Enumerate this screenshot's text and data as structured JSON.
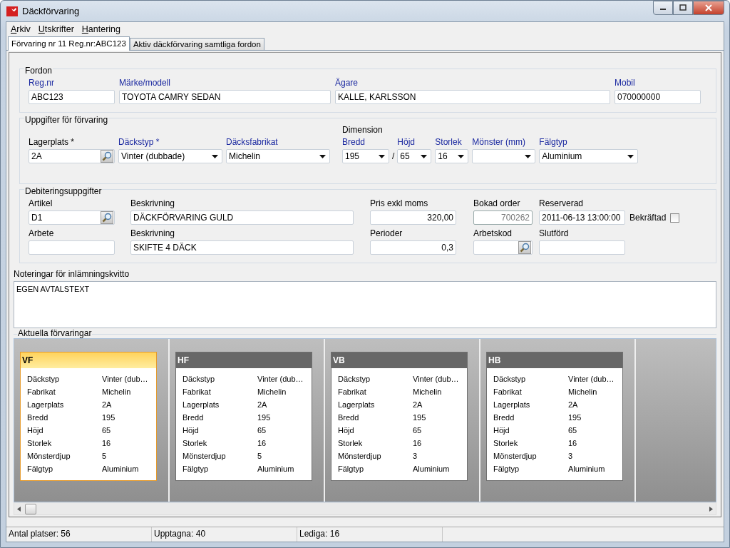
{
  "window": {
    "title": "Däckförvaring"
  },
  "menu": [
    {
      "label": "Arkiv"
    },
    {
      "label": "Utskrifter"
    },
    {
      "label": "Hantering"
    }
  ],
  "tabs": [
    {
      "label": "Förvaring nr 11 Reg.nr:ABC123",
      "selected": true
    },
    {
      "label": "Aktiv däckförvaring samtliga fordon",
      "selected": false
    }
  ],
  "fordon": {
    "title": "Fordon",
    "fields": [
      {
        "label": "Reg.nr",
        "highlighted": true,
        "kind": "text",
        "value": "ABC123"
      },
      {
        "label": "Märke/modell",
        "highlighted": true,
        "kind": "text",
        "value": "TOYOTA CAMRY SEDAN"
      },
      {
        "label": "Ägare",
        "highlighted": true,
        "kind": "text",
        "value": "KALLE, KARLSSON"
      },
      {
        "label": "Mobil",
        "highlighted": true,
        "kind": "text",
        "value": "070000000"
      }
    ]
  },
  "forvaring": {
    "title": "Uppgifter för förvaring",
    "dimension_label": "Dimension",
    "separator": "/",
    "fields": [
      {
        "label": "Lagerplats *",
        "highlighted": false,
        "kind": "lookup",
        "value": "2A"
      },
      {
        "label": "Däckstyp *",
        "highlighted": true,
        "kind": "combo",
        "value": "Vinter (dubbade)"
      },
      {
        "label": "Däcksfabrikat",
        "highlighted": true,
        "kind": "combo",
        "value": "Michelin"
      },
      {
        "label": "Bredd",
        "highlighted": true,
        "kind": "combo",
        "value": "195"
      },
      {
        "label": "Höjd",
        "highlighted": true,
        "kind": "combo",
        "value": "65"
      },
      {
        "label": "Storlek",
        "highlighted": true,
        "kind": "combo",
        "value": "16"
      },
      {
        "label": "Mönster (mm)",
        "highlighted": true,
        "kind": "combo"
      },
      {
        "label": "Fälgtyp",
        "highlighted": true,
        "kind": "combo",
        "value": "Aluminium"
      }
    ]
  },
  "debitering": {
    "title": "Debiteringsuppgifter",
    "rows": [
      [
        {
          "label": "Artikel",
          "kind": "lookup",
          "value": "D1"
        },
        {
          "label": "Beskrivning",
          "kind": "text",
          "value": "DÄCKFÖRVARING GULD"
        },
        {
          "label": "Pris exkl moms",
          "kind": "number",
          "value": "320,00"
        },
        {
          "label": "Bokad order",
          "kind": "readonly",
          "value": "700262"
        },
        {
          "label": "Reserverad",
          "kind": "text",
          "value": "2011-06-13 13:00:00"
        },
        {
          "label": "Bekräftad",
          "kind": "checkbox",
          "checked": false
        }
      ],
      [
        {
          "label": "Arbete",
          "kind": "text"
        },
        {
          "label": "Beskrivning",
          "kind": "text",
          "value": "SKIFTE 4 DÄCK"
        },
        {
          "label": "Perioder",
          "kind": "number",
          "value": "0,3"
        },
        {
          "label": "Arbetskod",
          "kind": "lookup"
        },
        {
          "label": "Slutförd",
          "kind": "text"
        }
      ]
    ]
  },
  "notes": {
    "label": "Noteringar för inlämningskvitto",
    "value": "EGEN AVTALSTEXT"
  },
  "storage": {
    "title": "Aktuella förvaringar",
    "cards": [
      {
        "title": "VF",
        "selected": true,
        "rows": [
          {
            "label": "Däckstyp",
            "value": "Vinter (dub…"
          },
          {
            "label": "Fabrikat",
            "value": "Michelin"
          },
          {
            "label": "Lagerplats",
            "value": "2A"
          },
          {
            "label": "Bredd",
            "value": "195"
          },
          {
            "label": "Höjd",
            "value": "65"
          },
          {
            "label": "Storlek",
            "value": "16"
          },
          {
            "label": "Mönsterdjup",
            "value": "5"
          },
          {
            "label": "Fälgtyp",
            "value": "Aluminium"
          }
        ]
      },
      {
        "title": "HF",
        "selected": false,
        "rows": [
          {
            "label": "Däckstyp",
            "value": "Vinter (dub…"
          },
          {
            "label": "Fabrikat",
            "value": "Michelin"
          },
          {
            "label": "Lagerplats",
            "value": "2A"
          },
          {
            "label": "Bredd",
            "value": "195"
          },
          {
            "label": "Höjd",
            "value": "65"
          },
          {
            "label": "Storlek",
            "value": "16"
          },
          {
            "label": "Mönsterdjup",
            "value": "5"
          },
          {
            "label": "Fälgtyp",
            "value": "Aluminium"
          }
        ]
      },
      {
        "title": "VB",
        "selected": false,
        "rows": [
          {
            "label": "Däckstyp",
            "value": "Vinter (dub…"
          },
          {
            "label": "Fabrikat",
            "value": "Michelin"
          },
          {
            "label": "Lagerplats",
            "value": "2A"
          },
          {
            "label": "Bredd",
            "value": "195"
          },
          {
            "label": "Höjd",
            "value": "65"
          },
          {
            "label": "Storlek",
            "value": "16"
          },
          {
            "label": "Mönsterdjup",
            "value": "3"
          },
          {
            "label": "Fälgtyp",
            "value": "Aluminium"
          }
        ]
      },
      {
        "title": "HB",
        "selected": false,
        "rows": [
          {
            "label": "Däckstyp",
            "value": "Vinter (dub…"
          },
          {
            "label": "Fabrikat",
            "value": "Michelin"
          },
          {
            "label": "Lagerplats",
            "value": "2A"
          },
          {
            "label": "Bredd",
            "value": "195"
          },
          {
            "label": "Höjd",
            "value": "65"
          },
          {
            "label": "Storlek",
            "value": "16"
          },
          {
            "label": "Mönsterdjup",
            "value": "3"
          },
          {
            "label": "Fälgtyp",
            "value": "Aluminium"
          }
        ]
      }
    ]
  },
  "status_bar": [
    "Antal platser: 56",
    "Upptagna: 40",
    "Lediga: 16"
  ]
}
